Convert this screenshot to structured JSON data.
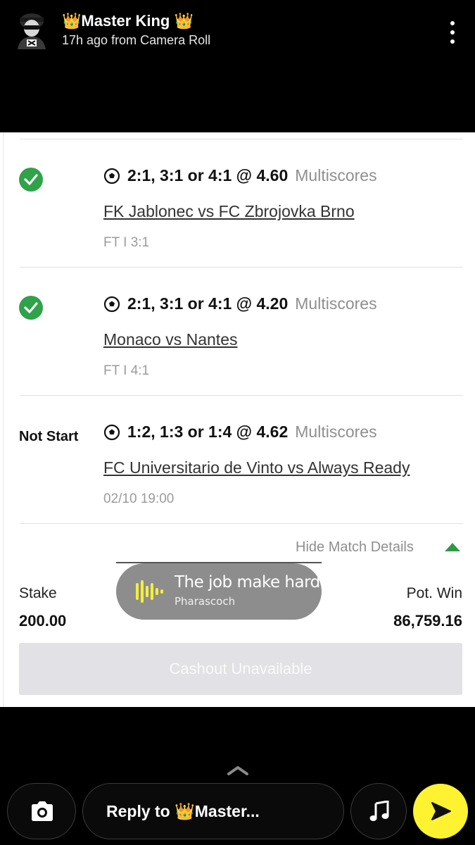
{
  "header": {
    "crown_left": "👑",
    "user_name": "Master King",
    "crown_right": "👑",
    "meta": "17h ago from Camera Roll",
    "more_icon": "vertical-ellipsis-icon"
  },
  "bets": [
    {
      "status": "won",
      "status_icon": "green-check-icon",
      "pick": "2:1, 3:1 or 4:1 @ 4.60",
      "pick_type": "Multiscores",
      "match": "FK Jablonec vs FC Zbrojovka Brno",
      "result": "FT I 3:1"
    },
    {
      "status": "won",
      "status_icon": "green-check-icon",
      "pick": "2:1, 3:1 or 4:1 @ 4.20",
      "pick_type": "Multiscores",
      "match": "Monaco vs Nantes",
      "result": "FT I 4:1"
    },
    {
      "status": "Not Start",
      "pick": "1:2, 1:3 or 1:4 @ 4.62",
      "pick_type": "Multiscores",
      "match": "FC Universitario de Vinto vs Always Ready",
      "result": "02/10 19:00"
    }
  ],
  "details_toggle": "Hide Match Details",
  "stake": {
    "label": "Stake",
    "value": "200.00"
  },
  "pot_win": {
    "label": "Pot. Win",
    "value": "86,759.16"
  },
  "cashout_label": "Cashout Unavailable",
  "music_sticker": {
    "title": "The job make hard",
    "artist": "Pharascoch"
  },
  "footer": {
    "reply_placeholder": "Reply to 👑Master..."
  },
  "colors": {
    "check_green": "#2fa24a",
    "send_yellow": "#fff331",
    "cashout_bg": "#e1e1e6",
    "sticker_gray": "#8d8d8d"
  }
}
